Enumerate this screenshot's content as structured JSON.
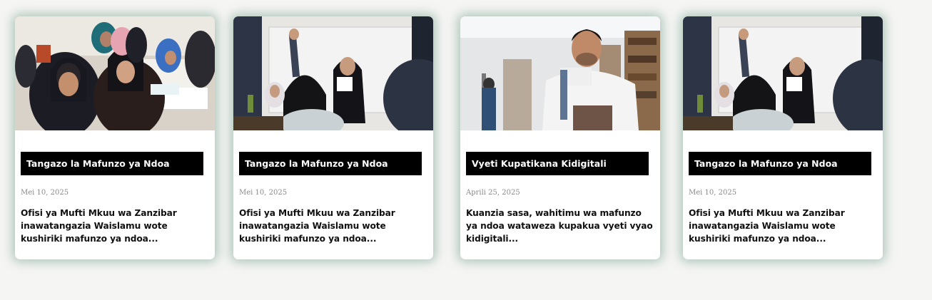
{
  "cards": [
    {
      "image": "students-classroom-photo",
      "title": "Tangazo la Mafunzo ya Ndoa",
      "date": "Mei 10, 2025",
      "excerpt": "Ofisi ya Mufti Mkuu wa Zanzibar inawatangazia Waislamu wote kushiriki mafunzo ya ndoa..."
    },
    {
      "image": "lecture-hall-photo",
      "title": "Tangazo la Mafunzo ya Ndoa",
      "date": "Mei 10, 2025",
      "excerpt": "Ofisi ya Mufti Mkuu wa Zanzibar inawatangazia Waislamu wote kushiriki mafunzo ya ndoa..."
    },
    {
      "image": "graduate-student-photo",
      "title": "Vyeti Kupatikana Kidigitali",
      "date": "Aprili 25, 2025",
      "excerpt": "Kuanzia sasa, wahitimu wa mafunzo ya ndoa wataweza kupakua vyeti vyao kidigitali..."
    },
    {
      "image": "lecture-hall-photo",
      "title": "Tangazo la Mafunzo ya Ndoa",
      "date": "Mei 10, 2025",
      "excerpt": "Ofisi ya Mufti Mkuu wa Zanzibar inawatangazia Waislamu wote kushiriki mafunzo ya ndoa..."
    }
  ]
}
